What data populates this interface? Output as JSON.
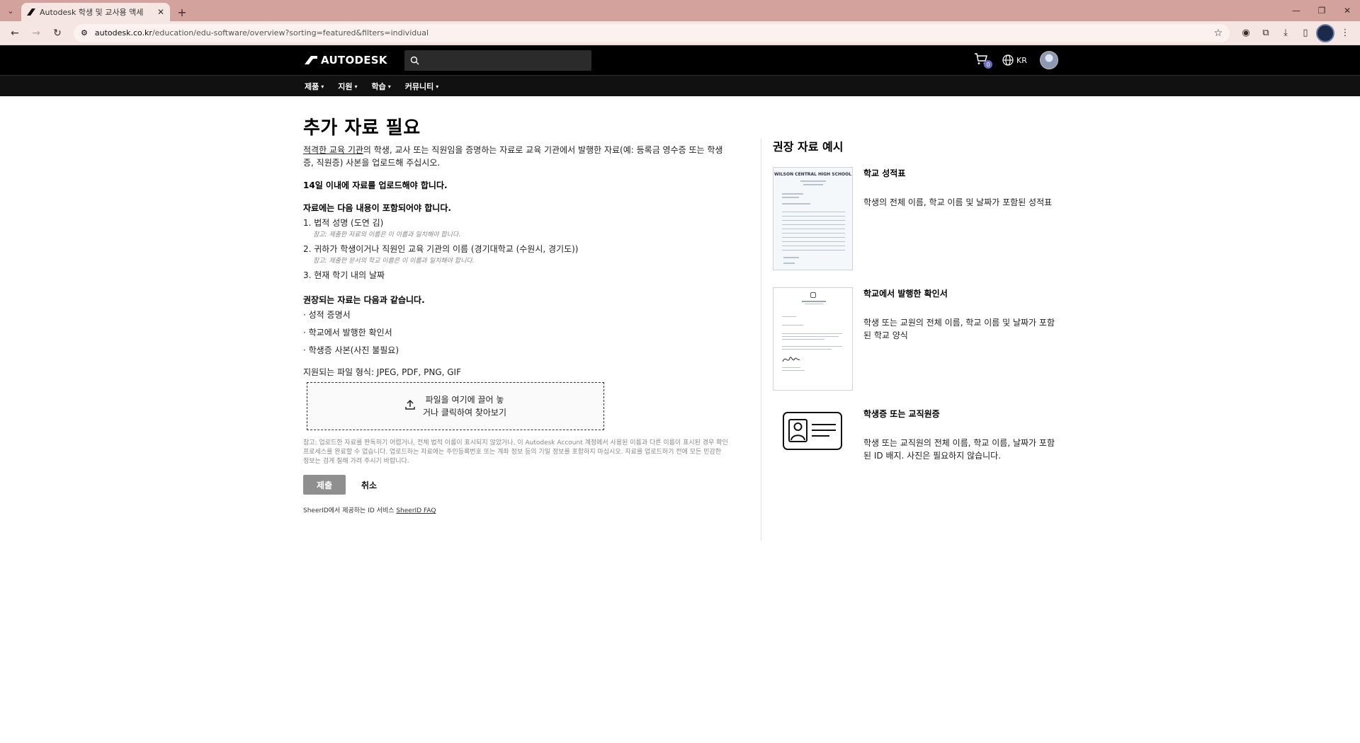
{
  "browser": {
    "tab_title": "Autodesk 학생 및 교사용 액세",
    "url_host": "autodesk.co.kr",
    "url_path": "/education/edu-software/overview?sorting=featured&filters=individual"
  },
  "header": {
    "logo_text": "AUTODESK",
    "search_placeholder": "",
    "cart_count": "0",
    "lang_label": "KR"
  },
  "nav": {
    "items": [
      "제품",
      "지원",
      "학습",
      "커뮤니티"
    ]
  },
  "main": {
    "title": "추가 자료 필요",
    "intro_link": "적격한 교육 기관",
    "intro_rest": "의 학생, 교사 또는 직원임을 증명하는 자료로 교육 기관에서 발행한 자료(예: 등록금 영수증 또는 학생증, 직원증) 사본을 업로드해 주십시오.",
    "deadline": "14일 이내에 자료를 업로드해야 합니다.",
    "requirements_title": "자료에는 다음 내용이 포함되어야 합니다.",
    "req1": "1. 법적 성명 (도연 김)",
    "req1_note": "참고: 제출한 자료의 이름은 이 이름과 일치해야 합니다.",
    "req2": "2. 귀하가 학생이거나 직원인 교육 기관의 이름 (경기대학교 (수원시, 경기도))",
    "req2_note": "참고: 제출한 문서의 학교 이름은 이 이름과 일치해야 합니다.",
    "req3": "3. 현재 학기 내의 날짜",
    "recommended_title": "권장되는 자료는 다음과 같습니다.",
    "rec1": "· 성적 증명서",
    "rec2": "· 학교에서 발행한 확인서",
    "rec3": "· 학생증 사본(사진 불필요)",
    "formats": "지원되는 파일 형식: JPEG, PDF, PNG, GIF",
    "drop_line1": "파일을 여기에 끌어 놓",
    "drop_line2": "거나 클릭하여 찾아보기",
    "fine_print": "참고: 업로드한 자료를 판독하기 어렵거나, 전체 법적 이름이 표시되지 않았거나, 이 Autodesk Account 계정에서 사용된 이름과 다른 이름이 표시된 경우 확인 프로세스를 완료할 수 없습니다. 업로드하는 자료에는 주민등록번호 또는 계좌 정보 등의 기밀 정보를 포함하지 마십시오. 자료를 업로드하기 전에 모든 민감한 정보는 검게 칠해 가려 주시기 바랍니다.",
    "submit_label": "제출",
    "cancel_label": "취소",
    "sheer_prefix": "SheerID에서 제공하는 ID 서비스",
    "sheer_link": "SheerID FAQ"
  },
  "examples": {
    "title": "권장 자료 예시",
    "items": [
      {
        "title": "학교 성적표",
        "desc": "학생의 전체 이름, 학교 이름 및 날짜가 포함된 성적표",
        "thumb_heading": "WILSON CENTRAL HIGH SCHOOL"
      },
      {
        "title": "학교에서 발행한 확인서",
        "desc": "학생 또는 교원의 전체 이름, 학교 이름 및 날짜가 포함된 학교 양식"
      },
      {
        "title": "학생증 또는 교직원증",
        "desc": "학생 또는 교직원의 전체 이름, 학교 이름, 날짜가 포함된 ID 배지. 사진은 필요하지 않습니다."
      }
    ]
  }
}
